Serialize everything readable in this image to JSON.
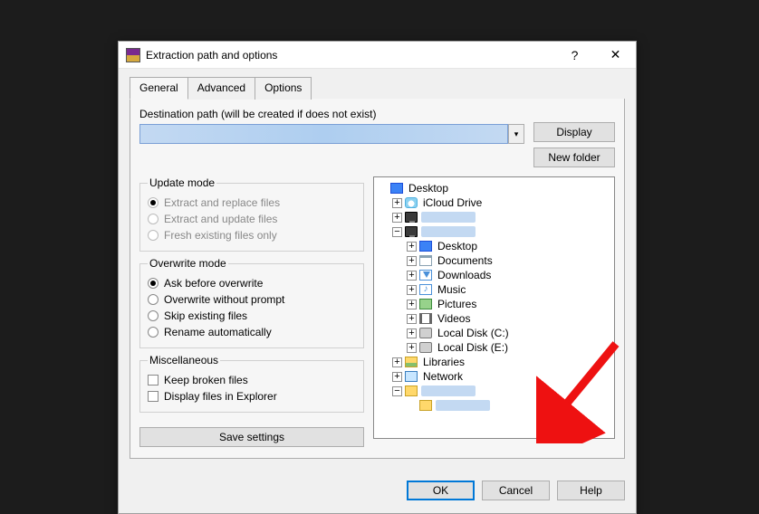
{
  "window": {
    "title": "Extraction path and options",
    "help_glyph": "?",
    "close_glyph": "✕"
  },
  "tabs": {
    "general": "General",
    "advanced": "Advanced",
    "options": "Options",
    "active": "general"
  },
  "path": {
    "label": "Destination path (will be created if does not exist)",
    "value": "(redacted)",
    "dropdown_glyph": "▾"
  },
  "side_buttons": {
    "display": "Display",
    "new_folder": "New folder"
  },
  "groups": {
    "update_mode": {
      "legend": "Update mode",
      "extract_replace": "Extract and replace files",
      "extract_update": "Extract and update files",
      "fresh_only": "Fresh existing files only",
      "selected": "extract_replace",
      "enabled": false
    },
    "overwrite_mode": {
      "legend": "Overwrite mode",
      "ask": "Ask before overwrite",
      "noprompt": "Overwrite without prompt",
      "skip": "Skip existing files",
      "rename": "Rename automatically",
      "selected": "ask"
    },
    "misc": {
      "legend": "Miscellaneous",
      "keep_broken": "Keep broken files",
      "display_explorer": "Display files in Explorer",
      "keep_broken_checked": false,
      "display_explorer_checked": false
    }
  },
  "save_settings": "Save settings",
  "tree": {
    "desktop": "Desktop",
    "icloud": "iCloud Drive",
    "user": "(redacted)",
    "pc": "(redacted)",
    "pc_desktop": "Desktop",
    "documents": "Documents",
    "downloads": "Downloads",
    "music": "Music",
    "pictures": "Pictures",
    "videos": "Videos",
    "disk_c": "Local Disk (C:)",
    "disk_e": "Local Disk (E:)",
    "libraries": "Libraries",
    "network": "Network",
    "redacted_folder_a": "(redacted)",
    "redacted_folder_b": "(redacted)"
  },
  "tree_glyphs": {
    "plus": "+",
    "minus": "−",
    "music_note": "♪"
  },
  "buttons": {
    "ok": "OK",
    "cancel": "Cancel",
    "help": "Help"
  }
}
